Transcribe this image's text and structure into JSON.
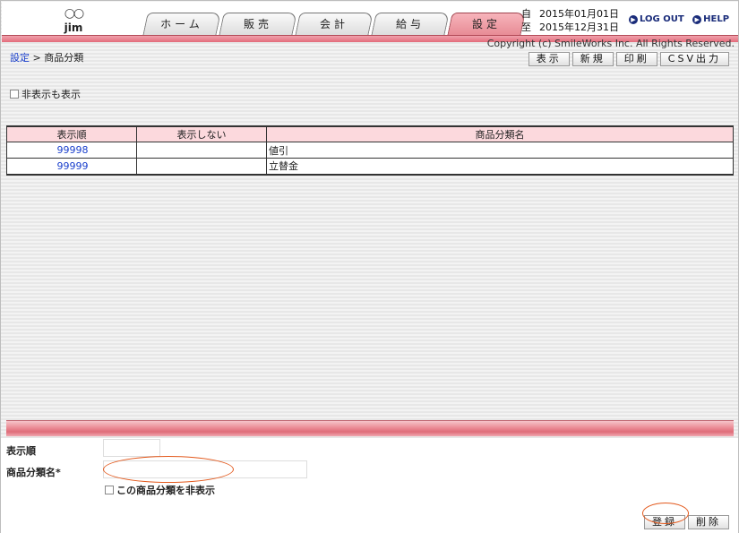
{
  "header": {
    "user_logo": "○○",
    "user_name": "jim",
    "tabs": [
      {
        "label": "ホーム",
        "active": false
      },
      {
        "label": "販売",
        "active": false
      },
      {
        "label": "会計",
        "active": false
      },
      {
        "label": "給与",
        "active": false
      },
      {
        "label": "設定",
        "active": true
      }
    ],
    "period": {
      "from_label": "自",
      "from_date": "2015年01月01日",
      "to_label": "至",
      "to_date": "2015年12月31日"
    },
    "logout_label": "LOG OUT",
    "help_label": "HELP",
    "copyright": "Copyright (c) SmileWorks Inc. All Rights Reserved."
  },
  "breadcrumb": {
    "parent": "設定",
    "separator": " > ",
    "current": "商品分類"
  },
  "actions": [
    "表示",
    "新規",
    "印刷",
    "CSV出力"
  ],
  "show_hidden_label": "非表示も表示",
  "table": {
    "headers": [
      "表示順",
      "表示しない",
      "商品分類名"
    ],
    "rows": [
      {
        "order": "99998",
        "hidden": "",
        "name": "値引"
      },
      {
        "order": "99999",
        "hidden": "",
        "name": "立替金"
      }
    ]
  },
  "form": {
    "order_label": "表示順",
    "order_value": "",
    "name_label": "商品分類名*",
    "name_value": "",
    "hide_label": "この商品分類を非表示",
    "register_label": "登録",
    "delete_label": "削除"
  },
  "colors": {
    "accent": "#e36c7b",
    "link": "#1a3fcc",
    "highlight": "#e35a1e"
  }
}
